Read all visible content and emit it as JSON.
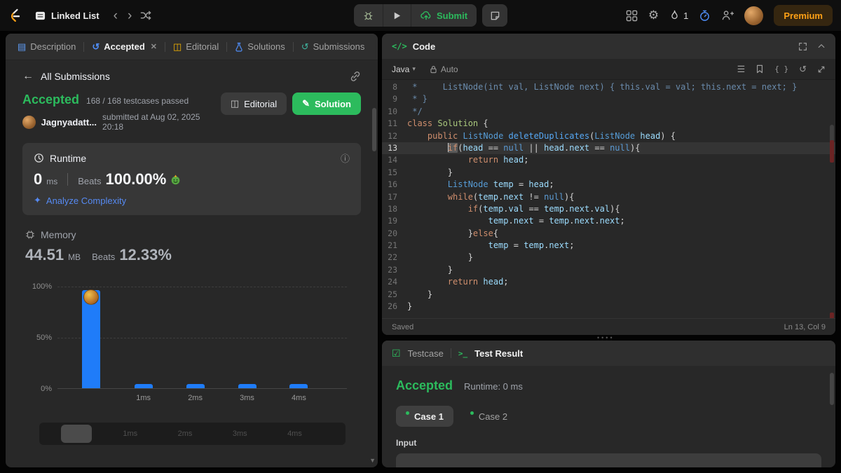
{
  "topbar": {
    "problem_list_label": "Linked List",
    "submit_label": "Submit",
    "streak_count": "1",
    "premium_label": "Premium"
  },
  "left_panel": {
    "tabs": {
      "description": "Description",
      "accepted": "Accepted",
      "editorial": "Editorial",
      "solutions": "Solutions",
      "submissions": "Submissions"
    },
    "back_link": "All Submissions",
    "result_header": {
      "status": "Accepted",
      "testcases": "168 / 168 testcases passed",
      "username": "Jagnyadatt...",
      "submitted": "submitted at Aug 02, 2025 20:18",
      "editorial_button": "Editorial",
      "solution_button": "Solution"
    },
    "runtime_card": {
      "title": "Runtime",
      "value": "0",
      "unit": "ms",
      "beats_label": "Beats",
      "beats_value": "100.00%",
      "analyze_link": "Analyze Complexity"
    },
    "memory_section": {
      "title": "Memory",
      "value": "44.51",
      "unit": "MB",
      "beats_label": "Beats",
      "beats_value": "12.33%"
    }
  },
  "chart_data": {
    "type": "bar",
    "title": "Runtime distribution",
    "categories": [
      "0 ms",
      "1 ms",
      "2 ms",
      "3 ms",
      "4 ms"
    ],
    "values": [
      96,
      4,
      4,
      4,
      4
    ],
    "x_tick_labels": [
      "",
      "1ms",
      "2ms",
      "3ms",
      "4ms"
    ],
    "y_ticks": [
      "0%",
      "50%",
      "100%"
    ],
    "ylim": [
      0,
      100
    ],
    "bar_color": "#1f7cf9",
    "user_marker_index": 0,
    "grid": "horizontal",
    "legend": "none"
  },
  "slider": {
    "labels": [
      "1ms",
      "2ms",
      "3ms",
      "4ms"
    ]
  },
  "code_panel": {
    "title": "Code",
    "language": "Java",
    "autocomplete_label": "Auto",
    "status_saved": "Saved",
    "cursor_position": "Ln 13, Col 9",
    "active_line": 13,
    "lines": [
      {
        "n": 8,
        "tokens": [
          [
            "c",
            " *     ListNode(int val, ListNode next) { this.val = val; this.next = next; }"
          ]
        ]
      },
      {
        "n": 9,
        "tokens": [
          [
            "c",
            " * }"
          ]
        ]
      },
      {
        "n": 10,
        "tokens": [
          [
            "c",
            " */"
          ]
        ]
      },
      {
        "n": 11,
        "tokens": [
          [
            "k",
            "class"
          ],
          [
            "p",
            " "
          ],
          [
            "ty2",
            "Solution"
          ],
          [
            "p",
            " {"
          ]
        ]
      },
      {
        "n": 12,
        "tokens": [
          [
            "p",
            "    "
          ],
          [
            "k",
            "public"
          ],
          [
            "p",
            " "
          ],
          [
            "t",
            "ListNode"
          ],
          [
            "p",
            " "
          ],
          [
            "fn",
            "deleteDuplicates"
          ],
          [
            "p",
            "("
          ],
          [
            "t",
            "ListNode"
          ],
          [
            "p",
            " "
          ],
          [
            "v",
            "head"
          ],
          [
            "p",
            ") {"
          ]
        ]
      },
      {
        "n": 13,
        "active": true,
        "tokens": [
          [
            "p",
            "        "
          ],
          [
            "cur",
            ""
          ],
          [
            "ksel",
            "if"
          ],
          [
            "p",
            "("
          ],
          [
            "v",
            "head"
          ],
          [
            "p",
            " == "
          ],
          [
            "kb",
            "null"
          ],
          [
            "p",
            " || "
          ],
          [
            "v",
            "head"
          ],
          [
            "p",
            "."
          ],
          [
            "v",
            "next"
          ],
          [
            "p",
            " == "
          ],
          [
            "kb",
            "null"
          ],
          [
            "p",
            "){"
          ]
        ]
      },
      {
        "n": 14,
        "tokens": [
          [
            "p",
            "            "
          ],
          [
            "k",
            "return"
          ],
          [
            "p",
            " "
          ],
          [
            "v",
            "head"
          ],
          [
            "p",
            ";"
          ]
        ]
      },
      {
        "n": 15,
        "tokens": [
          [
            "p",
            "        }"
          ]
        ]
      },
      {
        "n": 16,
        "tokens": [
          [
            "p",
            "        "
          ],
          [
            "t",
            "ListNode"
          ],
          [
            "p",
            " "
          ],
          [
            "v",
            "temp"
          ],
          [
            "p",
            " = "
          ],
          [
            "v",
            "head"
          ],
          [
            "p",
            ";"
          ]
        ]
      },
      {
        "n": 17,
        "tokens": [
          [
            "p",
            "        "
          ],
          [
            "k",
            "while"
          ],
          [
            "p",
            "("
          ],
          [
            "v",
            "temp"
          ],
          [
            "p",
            "."
          ],
          [
            "v",
            "next"
          ],
          [
            "p",
            " != "
          ],
          [
            "kb",
            "null"
          ],
          [
            "p",
            "){"
          ]
        ]
      },
      {
        "n": 18,
        "tokens": [
          [
            "p",
            "            "
          ],
          [
            "k",
            "if"
          ],
          [
            "p",
            "("
          ],
          [
            "v",
            "temp"
          ],
          [
            "p",
            "."
          ],
          [
            "v",
            "val"
          ],
          [
            "p",
            " == "
          ],
          [
            "v",
            "temp"
          ],
          [
            "p",
            "."
          ],
          [
            "v",
            "next"
          ],
          [
            "p",
            "."
          ],
          [
            "v",
            "val"
          ],
          [
            "p",
            "){"
          ]
        ]
      },
      {
        "n": 19,
        "tokens": [
          [
            "p",
            "                "
          ],
          [
            "v",
            "temp"
          ],
          [
            "p",
            "."
          ],
          [
            "v",
            "next"
          ],
          [
            "p",
            " = "
          ],
          [
            "v",
            "temp"
          ],
          [
            "p",
            "."
          ],
          [
            "v",
            "next"
          ],
          [
            "p",
            "."
          ],
          [
            "v",
            "next"
          ],
          [
            "p",
            ";"
          ]
        ]
      },
      {
        "n": 20,
        "tokens": [
          [
            "p",
            "            }"
          ],
          [
            "k",
            "else"
          ],
          [
            "p",
            "{"
          ]
        ]
      },
      {
        "n": 21,
        "tokens": [
          [
            "p",
            "                "
          ],
          [
            "v",
            "temp"
          ],
          [
            "p",
            " = "
          ],
          [
            "v",
            "temp"
          ],
          [
            "p",
            "."
          ],
          [
            "v",
            "next"
          ],
          [
            "p",
            ";"
          ]
        ]
      },
      {
        "n": 22,
        "tokens": [
          [
            "p",
            "            }"
          ]
        ]
      },
      {
        "n": 23,
        "tokens": [
          [
            "p",
            "        }"
          ]
        ]
      },
      {
        "n": 24,
        "tokens": [
          [
            "p",
            "        "
          ],
          [
            "k",
            "return"
          ],
          [
            "p",
            " "
          ],
          [
            "v",
            "head"
          ],
          [
            "p",
            ";"
          ]
        ]
      },
      {
        "n": 25,
        "tokens": [
          [
            "p",
            "    }"
          ]
        ]
      },
      {
        "n": 26,
        "tokens": [
          [
            "p",
            "}"
          ]
        ]
      }
    ]
  },
  "test_panel": {
    "testcase_tab": "Testcase",
    "result_tab": "Test Result",
    "status": "Accepted",
    "runtime_text": "Runtime: 0 ms",
    "case1": "Case 1",
    "case2": "Case 2",
    "input_label": "Input"
  },
  "colors": {
    "green": "#2cbb5d",
    "blue": "#1f7cf9",
    "orange": "#ffa116"
  }
}
